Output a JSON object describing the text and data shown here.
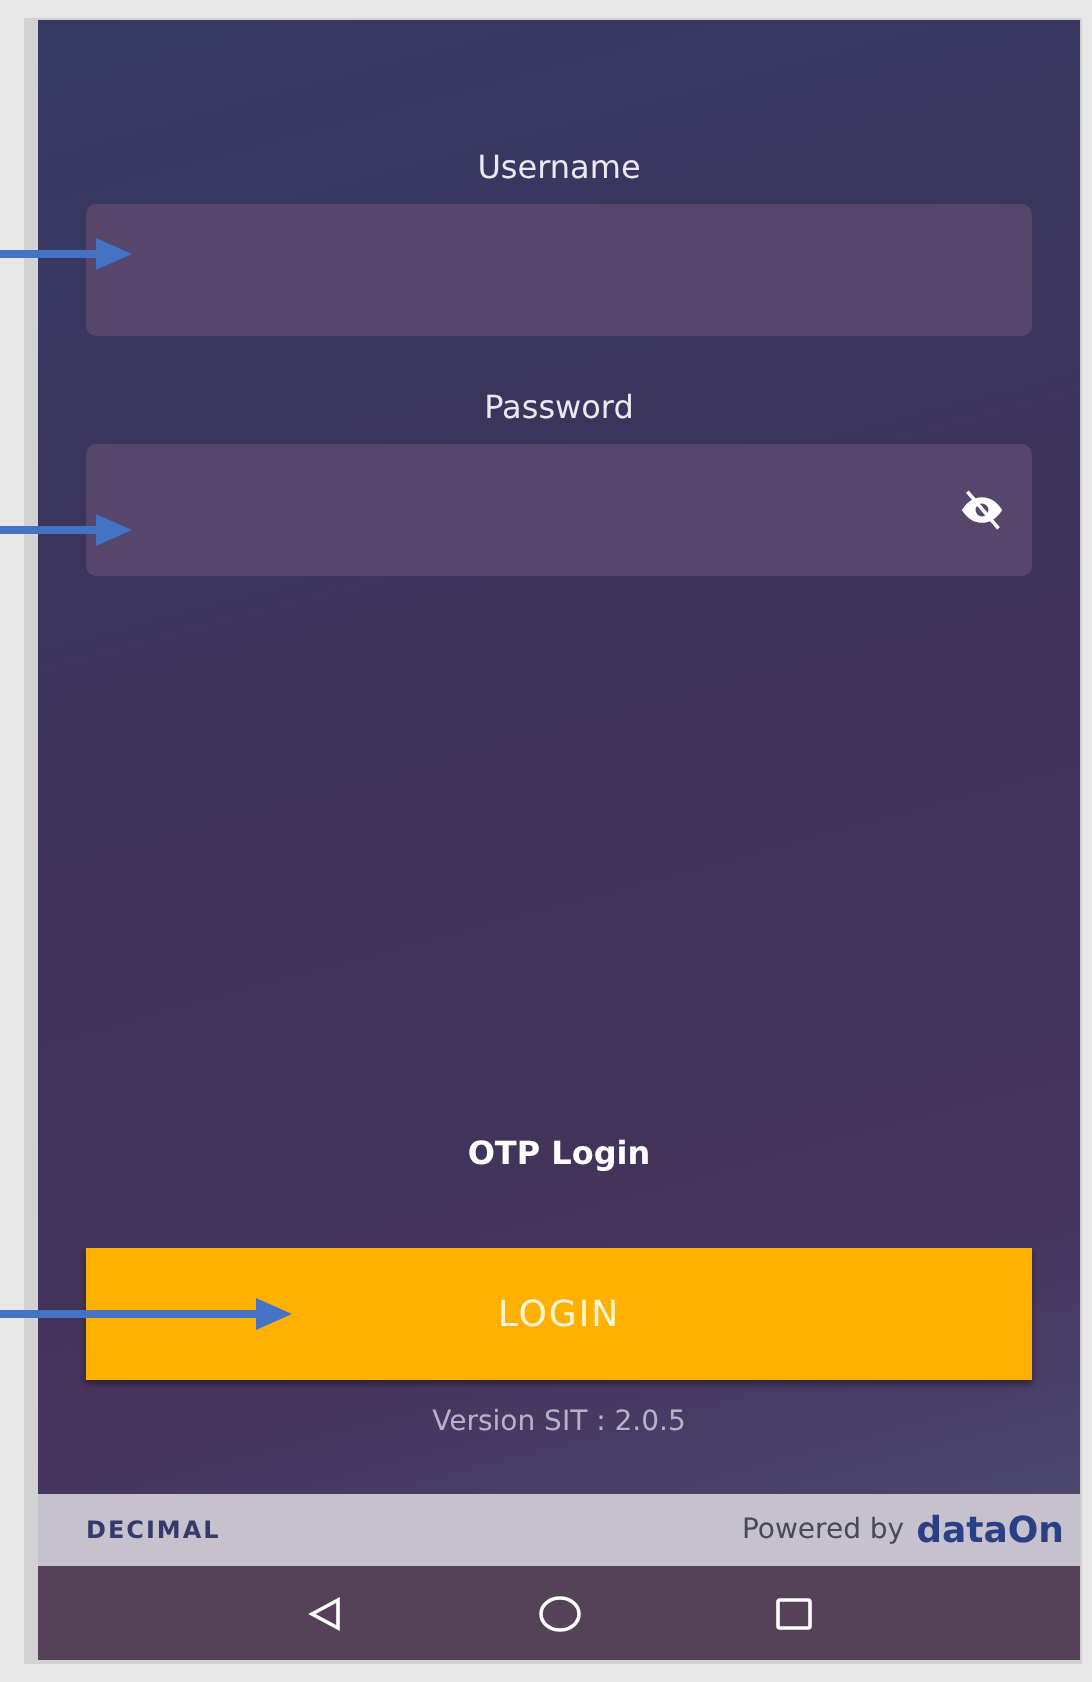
{
  "fields": [
    {
      "label": "Username",
      "kind": "text"
    },
    {
      "label": "Password",
      "kind": "password",
      "reveal": false
    }
  ],
  "otp_link": "OTP Login",
  "login_button": "LOGIN",
  "version": "Version SIT : 2.0.5",
  "footer": {
    "brand": "DECIMAL",
    "powered_by": "Powered by",
    "logo": "dataOn"
  },
  "annotations": [
    {
      "kind": "short-arrow"
    },
    {
      "kind": "short-arrow"
    },
    {
      "kind": "long-arrow"
    }
  ]
}
